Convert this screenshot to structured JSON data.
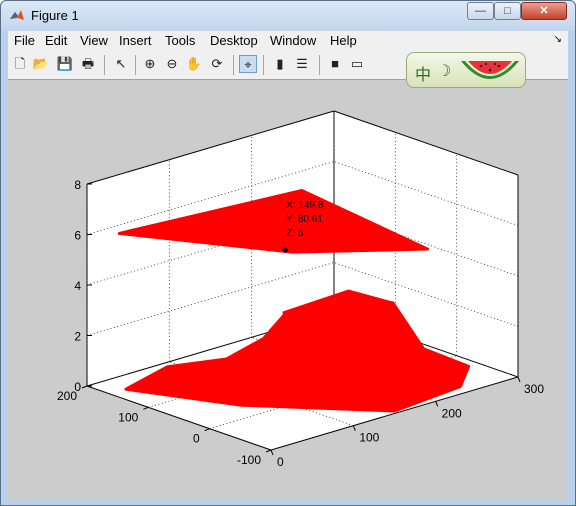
{
  "window": {
    "title": "Figure 1",
    "controls": {
      "minimize": "—",
      "maximize": "□",
      "close": "✕"
    }
  },
  "menu": {
    "items": [
      "File",
      "Edit",
      "View",
      "Insert",
      "Tools",
      "Desktop",
      "Window",
      "Help"
    ],
    "overflow_arrow": "↘"
  },
  "toolbar": {
    "buttons": [
      {
        "name": "new-figure-icon",
        "glyph": "🗋"
      },
      {
        "name": "open-file-icon",
        "glyph": "📂"
      },
      {
        "name": "save-icon",
        "glyph": "💾"
      },
      {
        "name": "print-icon",
        "glyph": "🖶"
      },
      {
        "name": "edit-plot-arrow-icon",
        "glyph": "↖"
      },
      {
        "name": "zoom-in-icon",
        "glyph": "⊕"
      },
      {
        "name": "zoom-out-icon",
        "glyph": "⊖"
      },
      {
        "name": "pan-hand-icon",
        "glyph": "✋"
      },
      {
        "name": "rotate-3d-icon",
        "glyph": "⟳"
      },
      {
        "name": "data-cursor-icon",
        "glyph": "⌖"
      },
      {
        "name": "insert-colorbar-icon",
        "glyph": "▮"
      },
      {
        "name": "insert-legend-icon",
        "glyph": "☰"
      },
      {
        "name": "hide-plot-tools-icon",
        "glyph": "■"
      },
      {
        "name": "show-plot-tools-icon",
        "glyph": "▭"
      }
    ],
    "active_tool": "data-cursor-icon"
  },
  "ime": {
    "char": "中",
    "mode": "☽"
  },
  "colors": {
    "marker": "#ff0000",
    "axes_bg": "#ffffff",
    "figure_bg": "#cccccc"
  },
  "chart_data": {
    "type": "scatter",
    "view": "3d",
    "marker": "x",
    "grid": true,
    "axes": {
      "x": {
        "ticks": [
          "0",
          "100",
          "200",
          "300"
        ],
        "range": [
          0,
          300
        ]
      },
      "y": {
        "ticks": [
          "-100",
          "0",
          "100",
          "200"
        ],
        "range": [
          -100,
          200
        ]
      },
      "z": {
        "ticks": [
          "0",
          "2",
          "4",
          "6",
          "8"
        ],
        "range": [
          0,
          8
        ]
      }
    },
    "datatip": {
      "x": "X: 149.8",
      "y": "Y: 80.61",
      "z": "Z: 5"
    }
  }
}
